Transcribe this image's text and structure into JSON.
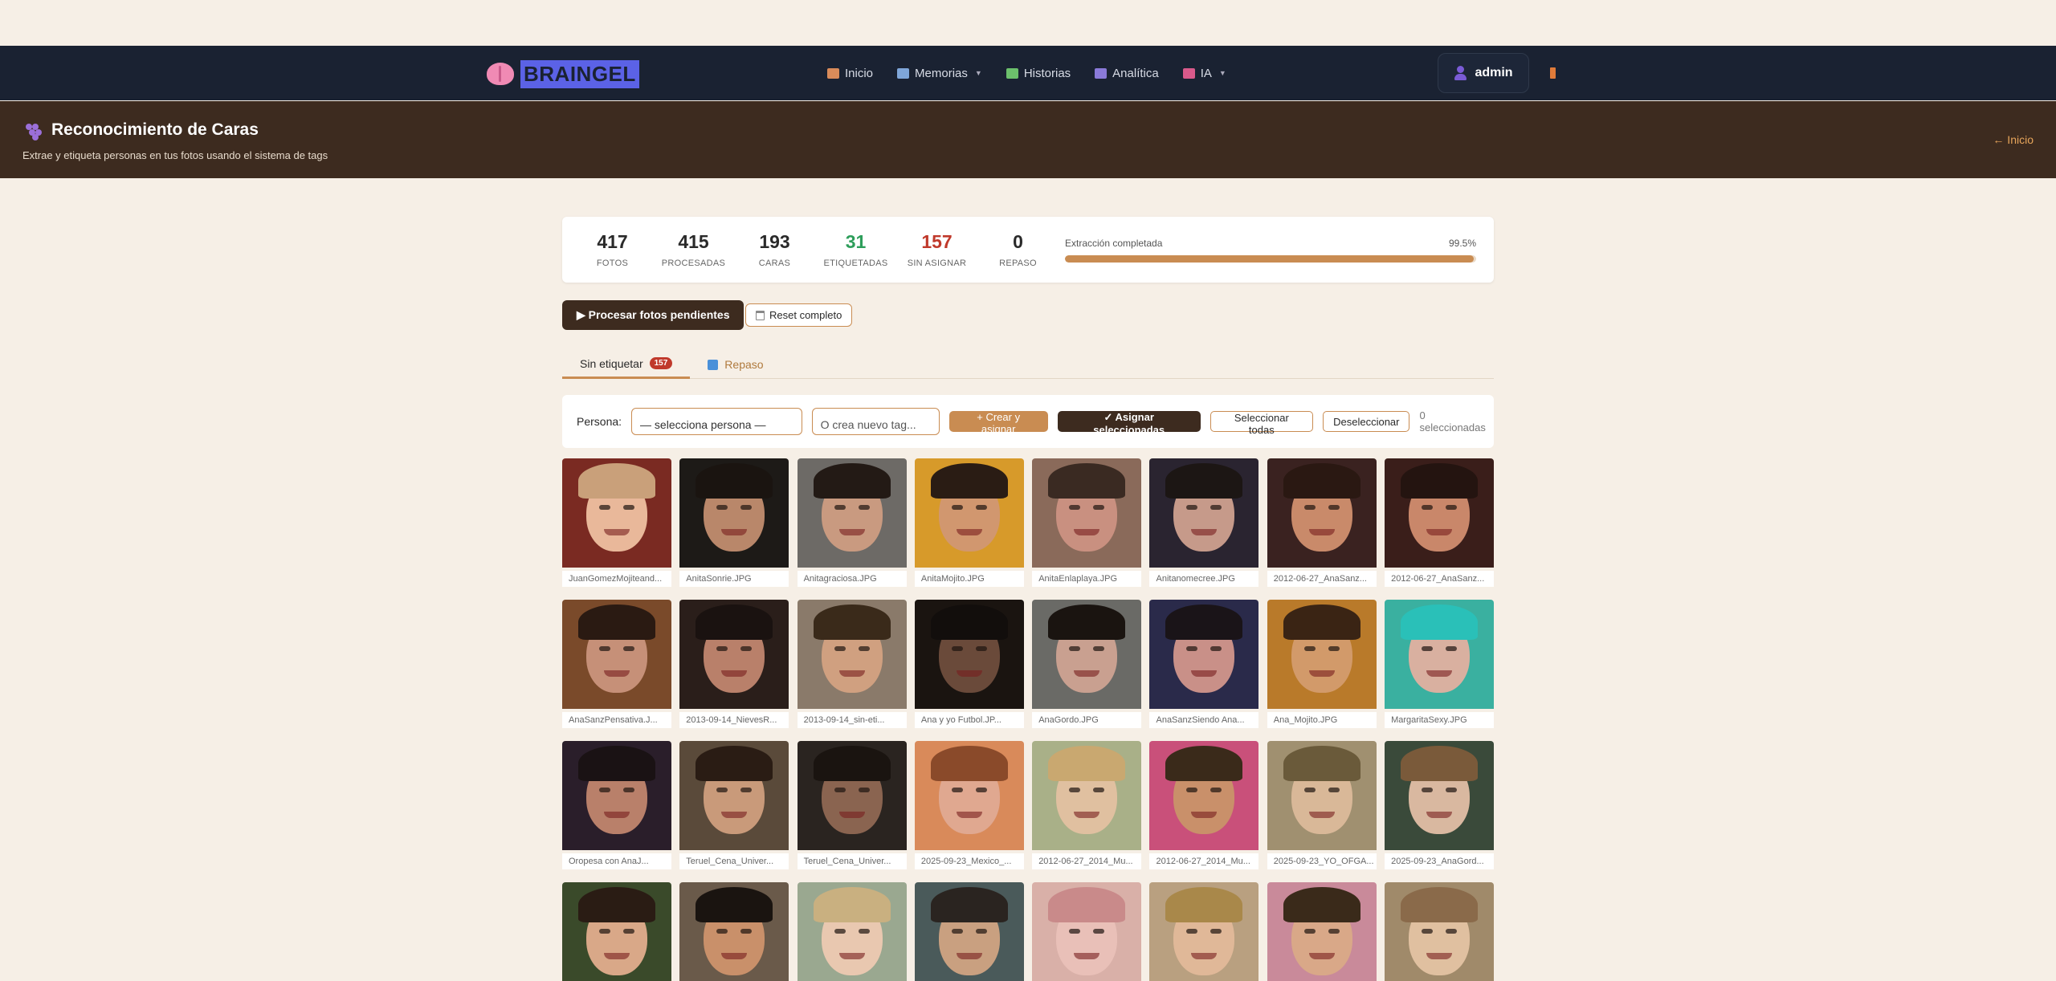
{
  "nav": {
    "brand": "BRAINGEL",
    "links": [
      {
        "label": "Inicio",
        "icon": "house-icon",
        "color": "#d98b5a",
        "caret": false
      },
      {
        "label": "Memorias",
        "icon": "photo-icon",
        "color": "#7fa6d9",
        "caret": true
      },
      {
        "label": "Historias",
        "icon": "books-icon",
        "color": "#6cc06c",
        "caret": false
      },
      {
        "label": "Analítica",
        "icon": "chart-icon",
        "color": "#8a7ad9",
        "caret": false
      },
      {
        "label": "IA",
        "icon": "robot-icon",
        "color": "#d95a8b",
        "caret": true
      }
    ],
    "user": "admin"
  },
  "hero": {
    "title": "Reconocimiento de Caras",
    "subtitle": "Extrae y etiqueta personas en tus fotos usando el sistema de tags",
    "back": "← Inicio"
  },
  "stats": [
    {
      "value": "417",
      "label": "FOTOS",
      "tone": ""
    },
    {
      "value": "415",
      "label": "PROCESADAS",
      "tone": ""
    },
    {
      "value": "193",
      "label": "CARAS",
      "tone": ""
    },
    {
      "value": "31",
      "label": "ETIQUETADAS",
      "tone": "green"
    },
    {
      "value": "157",
      "label": "SIN ASIGNAR",
      "tone": "red"
    },
    {
      "value": "0",
      "label": "REPASO",
      "tone": ""
    }
  ],
  "progress": {
    "label": "Extracción completada",
    "percent_text": "99.5%",
    "fraction": 0.995
  },
  "actions": {
    "process": "▶ Procesar fotos pendientes",
    "reset": "Reset completo"
  },
  "tabs": {
    "untagged": "Sin etiquetar",
    "untagged_count": "157",
    "review": "Repaso"
  },
  "assign": {
    "persona_label": "Persona:",
    "select_value": "— selecciona persona —",
    "new_tag_placeholder": "O crea nuevo tag...",
    "create_btn": "+ Crear y asignar",
    "assign_btn": "✓ Asignar seleccionadas",
    "select_all": "Seleccionar todas",
    "deselect": "Deseleccionar",
    "selected_count": "0 seleccionadas"
  },
  "faces": [
    {
      "caption": "JuanGomezMojiteand...",
      "bg": "#7a2a22",
      "skin": "#e9b89a",
      "hair": "#c9a07a"
    },
    {
      "caption": "AnitaSonrie.JPG",
      "bg": "#1d1a17",
      "skin": "#b9876a",
      "hair": "#1a1410"
    },
    {
      "caption": "Anitagraciosa.JPG",
      "bg": "#6d6a66",
      "skin": "#c99a80",
      "hair": "#231a15"
    },
    {
      "caption": "AnitaMojito.JPG",
      "bg": "#d79a2a",
      "skin": "#d1976f",
      "hair": "#2a1c14"
    },
    {
      "caption": "AnitaEnlaplaya.JPG",
      "bg": "#8a6a5a",
      "skin": "#c99080",
      "hair": "#3a2a22"
    },
    {
      "caption": "Anitanomecree.JPG",
      "bg": "#2a2430",
      "skin": "#c69a8a",
      "hair": "#1c1614"
    },
    {
      "caption": "2012-06-27_AnaSanz...",
      "bg": "#3a2220",
      "skin": "#c98a6a",
      "hair": "#2a1812"
    },
    {
      "caption": "2012-06-27_AnaSanz...",
      "bg": "#3a1e1a",
      "skin": "#c9876a",
      "hair": "#241410"
    },
    {
      "caption": "AnaSanzPensativa.J...",
      "bg": "#7a4a2a",
      "skin": "#c69078",
      "hair": "#2a1a12"
    },
    {
      "caption": "2013-09-14_NievesR...",
      "bg": "#2a1e1a",
      "skin": "#b9806a",
      "hair": "#1a1210"
    },
    {
      "caption": "2013-09-14_sin-eti...",
      "bg": "#8a7a6a",
      "skin": "#d0a080",
      "hair": "#3a2a1a"
    },
    {
      "caption": "Ana y yo Futbol.JP...",
      "bg": "#1a1410",
      "skin": "#6a4a3a",
      "hair": "#120e0c"
    },
    {
      "caption": "AnaGordo.JPG",
      "bg": "#6a6a66",
      "skin": "#c9a090",
      "hair": "#1a1410"
    },
    {
      "caption": "AnaSanzSiendo Ana...",
      "bg": "#2a2a4a",
      "skin": "#c99088",
      "hair": "#1a1418"
    },
    {
      "caption": "Ana_Mojito.JPG",
      "bg": "#b97a2a",
      "skin": "#d29a6a",
      "hair": "#3a2414"
    },
    {
      "caption": "MargaritaSexy.JPG",
      "bg": "#3ab0a0",
      "skin": "#d9b0a0",
      "hair": "#2ac0b8"
    },
    {
      "caption": "Oropesa con AnaJ...",
      "bg": "#2a1e2a",
      "skin": "#b9806a",
      "hair": "#1a1214"
    },
    {
      "caption": "Teruel_Cena_Univer...",
      "bg": "#5a4a3a",
      "skin": "#c99a7a",
      "hair": "#2a1c14"
    },
    {
      "caption": "Teruel_Cena_Univer...",
      "bg": "#2a2420",
      "skin": "#8a6450",
      "hair": "#1a1410"
    },
    {
      "caption": "2025-09-23_Mexico_...",
      "bg": "#d98a5a",
      "skin": "#e0a890",
      "hair": "#8a4a2a"
    },
    {
      "caption": "2012-06-27_2014_Mu...",
      "bg": "#a9b088",
      "skin": "#e0c0a0",
      "hair": "#c9a870"
    },
    {
      "caption": "2012-06-27_2014_Mu...",
      "bg": "#c9507a",
      "skin": "#c9906a",
      "hair": "#3a2a1a"
    },
    {
      "caption": "2025-09-23_YO_OFGA...",
      "bg": "#a09070",
      "skin": "#d9b898",
      "hair": "#6a5a3a"
    },
    {
      "caption": "2025-09-23_AnaGord...",
      "bg": "#3a4a3a",
      "skin": "#d9b8a0",
      "hair": "#7a5a3a"
    },
    {
      "caption": "",
      "bg": "#3a4a2a",
      "skin": "#d9a888",
      "hair": "#2a1c14"
    },
    {
      "caption": "",
      "bg": "#6a5a4a",
      "skin": "#c9906a",
      "hair": "#1a1410"
    },
    {
      "caption": "",
      "bg": "#9aa890",
      "skin": "#e9c8b0",
      "hair": "#c9b080"
    },
    {
      "caption": "",
      "bg": "#4a5a5a",
      "skin": "#c9a080",
      "hair": "#2a2420"
    },
    {
      "caption": "",
      "bg": "#d9b0a8",
      "skin": "#e9c0b8",
      "hair": "#c98a8a"
    },
    {
      "caption": "",
      "bg": "#b9a080",
      "skin": "#e0b898",
      "hair": "#a9884a"
    },
    {
      "caption": "",
      "bg": "#c98a9a",
      "skin": "#d9a888",
      "hair": "#3a2a1a"
    },
    {
      "caption": "",
      "bg": "#a08a6a",
      "skin": "#e0c0a0",
      "hair": "#8a6a4a"
    }
  ]
}
